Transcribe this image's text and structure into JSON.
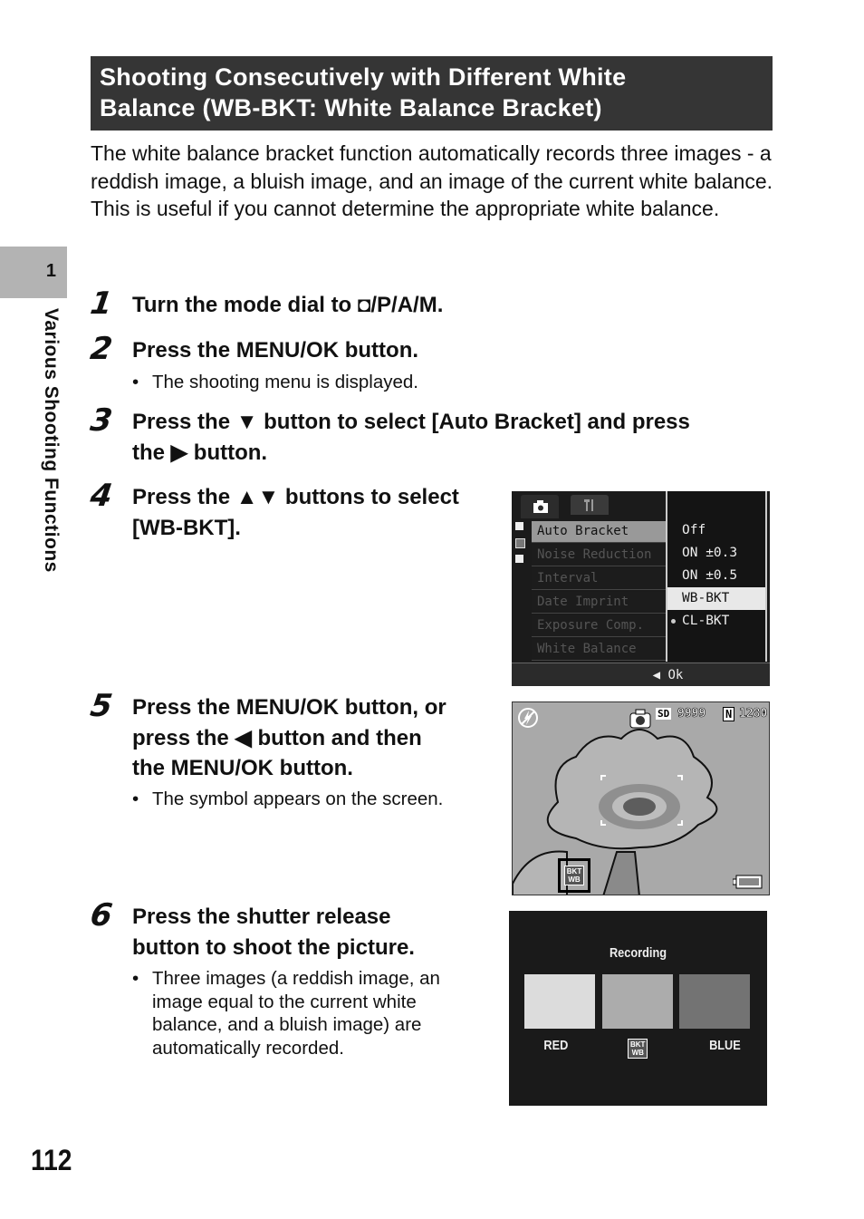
{
  "title": {
    "line1": "Shooting Consecutively with Different White",
    "line2": "Balance (WB-BKT: White Balance Bracket)"
  },
  "intro": [
    "The white balance bracket function automatically records three images - a reddish image, a bluish image, and an image of the current white balance.",
    "This is useful if you cannot determine the appropriate white balance."
  ],
  "sidebar": {
    "chapter_number": "1",
    "chapter_label": "Various Shooting Functions"
  },
  "steps": [
    {
      "num": "1",
      "text": "Turn the mode dial to ◘/P/A/M."
    },
    {
      "num": "2",
      "text": "Press the MENU/OK button.",
      "note": "The shooting menu is displayed."
    },
    {
      "num": "3",
      "text_line1": "Press the ▼ button to select [Auto Bracket] and press",
      "text_line2": "the ▶ button."
    },
    {
      "num": "4",
      "text_line1": "Press the ▲▼ buttons to select",
      "text_line2": "[WB-BKT]."
    },
    {
      "num": "5",
      "text_line1": "Press the MENU/OK button, or",
      "text_line2": "press the ◀ button and then",
      "text_line3": "the MENU/OK button.",
      "note": "The symbol appears on the screen."
    },
    {
      "num": "6",
      "text_line1": "Press the shutter release",
      "text_line2": "button to shoot the picture.",
      "note": "Three images (a reddish image, an image equal to the current white balance, and a bluish image) are automatically recorded."
    }
  ],
  "menu_screen": {
    "tabs": [
      "camera-icon",
      "wrench-icon"
    ],
    "items": [
      "Auto Bracket",
      "Noise Reduction",
      "Interval",
      "Date Imprint",
      "Exposure Comp.",
      "White Balance"
    ],
    "selected_item": "Auto Bracket",
    "options": [
      "Off",
      "ON ±0.3",
      "ON ±0.5",
      "WB-BKT",
      "CL-BKT"
    ],
    "highlighted_option": "WB-BKT",
    "current_option": "CL-BKT",
    "footer": "◀ Ok"
  },
  "live_screen": {
    "flash_icon": "flash-off-icon",
    "storage": "SD",
    "remaining": "9999",
    "quality": "N",
    "size": "1280",
    "bkt_badge_top": "BKT",
    "bkt_badge_bottom": "WB"
  },
  "recording_screen": {
    "title": "Recording",
    "labels": [
      "RED",
      "BLUE"
    ],
    "badge_top": "BKT",
    "badge_bottom": "WB"
  },
  "page_number": "112"
}
